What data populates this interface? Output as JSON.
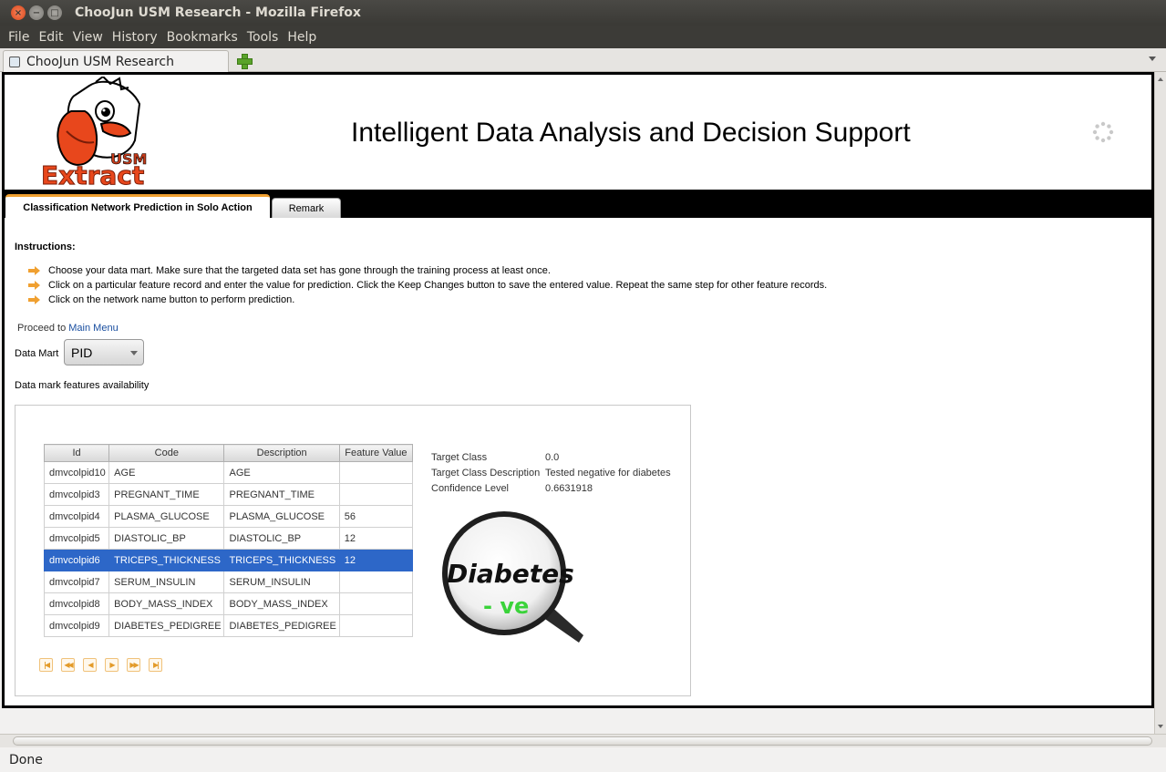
{
  "window": {
    "title": "ChooJun USM Research - Mozilla Firefox"
  },
  "menubar": {
    "items": [
      "File",
      "Edit",
      "View",
      "History",
      "Bookmarks",
      "Tools",
      "Help"
    ]
  },
  "browser_tab": {
    "label": "ChooJun USM Research"
  },
  "statusbar": {
    "text": "Done"
  },
  "header": {
    "logo_text": "Extract",
    "logo_subtext": "USM",
    "title": "Intelligent Data Analysis and Decision Support"
  },
  "app_tabs": [
    {
      "label": "Classification Network Prediction in Solo Action",
      "active": true
    },
    {
      "label": "Remark",
      "active": false
    }
  ],
  "instructions": {
    "title": "Instructions:",
    "items": [
      "Choose your data mart. Make sure that the targeted data set has gone through the training process at least once.",
      "Click on a particular feature record and enter the value for prediction. Click the Keep Changes button to save the entered value. Repeat the same step for other feature records.",
      "Click on the network name button to perform prediction."
    ]
  },
  "proceed": {
    "prefix": "Proceed to",
    "link": "Main Menu"
  },
  "datamart": {
    "label": "Data Mart",
    "value": "PID"
  },
  "features_label": "Data mark features availability",
  "grid": {
    "columns": [
      "Id",
      "Code",
      "Description",
      "Feature Value"
    ],
    "rows": [
      [
        "dmvcolpid10",
        "AGE",
        "AGE",
        ""
      ],
      [
        "dmvcolpid3",
        "PREGNANT_TIME",
        "PREGNANT_TIME",
        ""
      ],
      [
        "dmvcolpid4",
        "PLASMA_GLUCOSE",
        "PLASMA_GLUCOSE",
        "56"
      ],
      [
        "dmvcolpid5",
        "DIASTOLIC_BP",
        "DIASTOLIC_BP",
        "12"
      ],
      [
        "dmvcolpid6",
        "TRICEPS_THICKNESS",
        "TRICEPS_THICKNESS",
        "12"
      ],
      [
        "dmvcolpid7",
        "SERUM_INSULIN",
        "SERUM_INSULIN",
        ""
      ],
      [
        "dmvcolpid8",
        "BODY_MASS_INDEX",
        "BODY_MASS_INDEX",
        ""
      ],
      [
        "dmvcolpid9",
        "DIABETES_PEDIGREE",
        "DIABETES_PEDIGREE",
        ""
      ]
    ],
    "selected_row": 4
  },
  "pager": {
    "buttons": [
      "first-page-icon",
      "fast-back-icon",
      "prev-page-icon",
      "next-page-icon",
      "fast-forward-icon",
      "last-page-icon"
    ]
  },
  "result": {
    "target_class_label": "Target Class",
    "target_class_value": "0.0",
    "target_desc_label": "Target Class Description",
    "target_desc_value": "Tested negative for diabetes",
    "confidence_label": "Confidence Level",
    "confidence_value": "0.6631918"
  },
  "magnifier": {
    "word": "Diabetes",
    "sign": "- ve"
  },
  "colors": {
    "selection": "#2d67c8",
    "tab_accent": "#f0a030",
    "link": "#1a4fa0"
  }
}
